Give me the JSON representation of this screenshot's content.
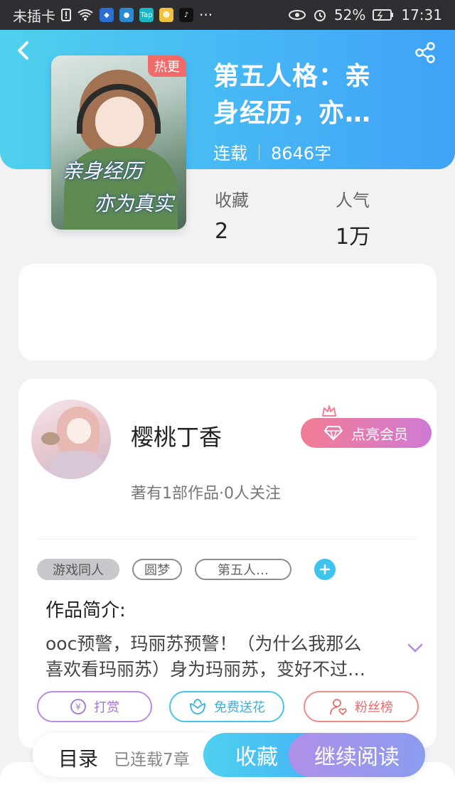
{
  "status_bar": {
    "carrier": "未插卡",
    "battery": "52%",
    "time": "17:31",
    "more": "···",
    "app_icons": [
      "shield-icon",
      "lightbulb-icon",
      "taptap-icon",
      "sun-app-icon",
      "tiktok-icon"
    ]
  },
  "book": {
    "hot_badge": "热更",
    "title_line1": "第五人格：亲",
    "title_line2": "身经历，亦…",
    "status": "连载",
    "word_count": "8646字",
    "cover_text_line1": "亲身经历",
    "cover_text_line2": "亦为真实"
  },
  "stats": {
    "favorites_label": "收藏",
    "favorites_value": "2",
    "popularity_label": "人气",
    "popularity_value": "1万"
  },
  "author": {
    "name": "樱桃丁香",
    "stats": "著有1部作品·0人关注",
    "vip_label": "点亮会员"
  },
  "tags": [
    "游戏同人",
    "圆梦",
    "第五人…"
  ],
  "intro": {
    "title": "作品简介:",
    "line1": "ooc预警，玛丽苏预警！（为什么我那么",
    "line2": "喜欢看玛丽苏）身为玛丽苏，变好不过…"
  },
  "actions": {
    "reward": "打赏",
    "flower": "免费送花",
    "fans": "粉丝榜",
    "reward_icon_glyph": "¥"
  },
  "bottom": {
    "toc": "目录",
    "chapters": "已连载7章",
    "favorite": "收藏",
    "continue_read": "继续阅读"
  },
  "colors": {
    "header_start": "#4fd1ee",
    "header_end": "#3fa2f6",
    "hot_badge": "#f06a6a",
    "vip_start": "#f27c93",
    "vip_end": "#d07ad6",
    "read_btn": "#b08fe8",
    "accent_blue": "#3fc3ef"
  }
}
